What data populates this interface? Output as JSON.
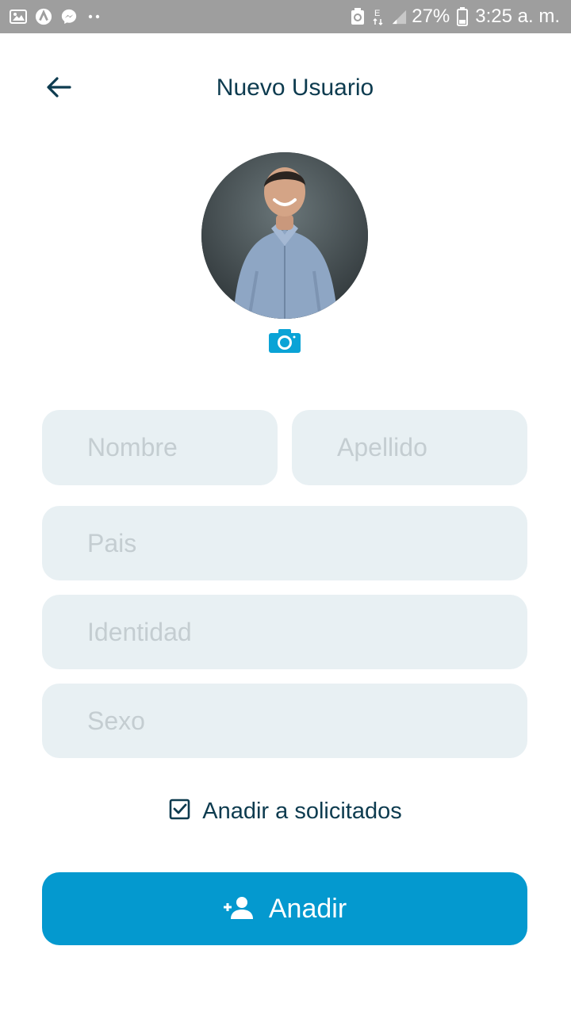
{
  "status_bar": {
    "battery_percent": "27%",
    "time": "3:25 a. m.",
    "network": "E",
    "left_icons": [
      "image-icon",
      "app-icon",
      "messenger-icon",
      "dots-icon"
    ],
    "right_icons": [
      "recycle-icon",
      "network-e-icon",
      "signal-icon",
      "battery-icon"
    ]
  },
  "header": {
    "title": "Nuevo Usuario",
    "back_icon": "arrow-back-icon"
  },
  "profile": {
    "camera_icon": "camera-icon"
  },
  "form": {
    "nombre_placeholder": "Nombre",
    "apellido_placeholder": "Apellido",
    "pais_placeholder": "Pais",
    "identidad_placeholder": "Identidad",
    "sexo_placeholder": "Sexo",
    "checkbox_label": "Anadir a solicitados",
    "checkbox_checked": true
  },
  "actions": {
    "add_label": "Anadir",
    "add_icon": "person-add-icon"
  },
  "colors": {
    "primary": "#0499cf",
    "title": "#0d3b4f",
    "field_bg": "#e8f0f3",
    "placeholder": "#c4cdd1",
    "status_bar": "#9e9e9e"
  }
}
